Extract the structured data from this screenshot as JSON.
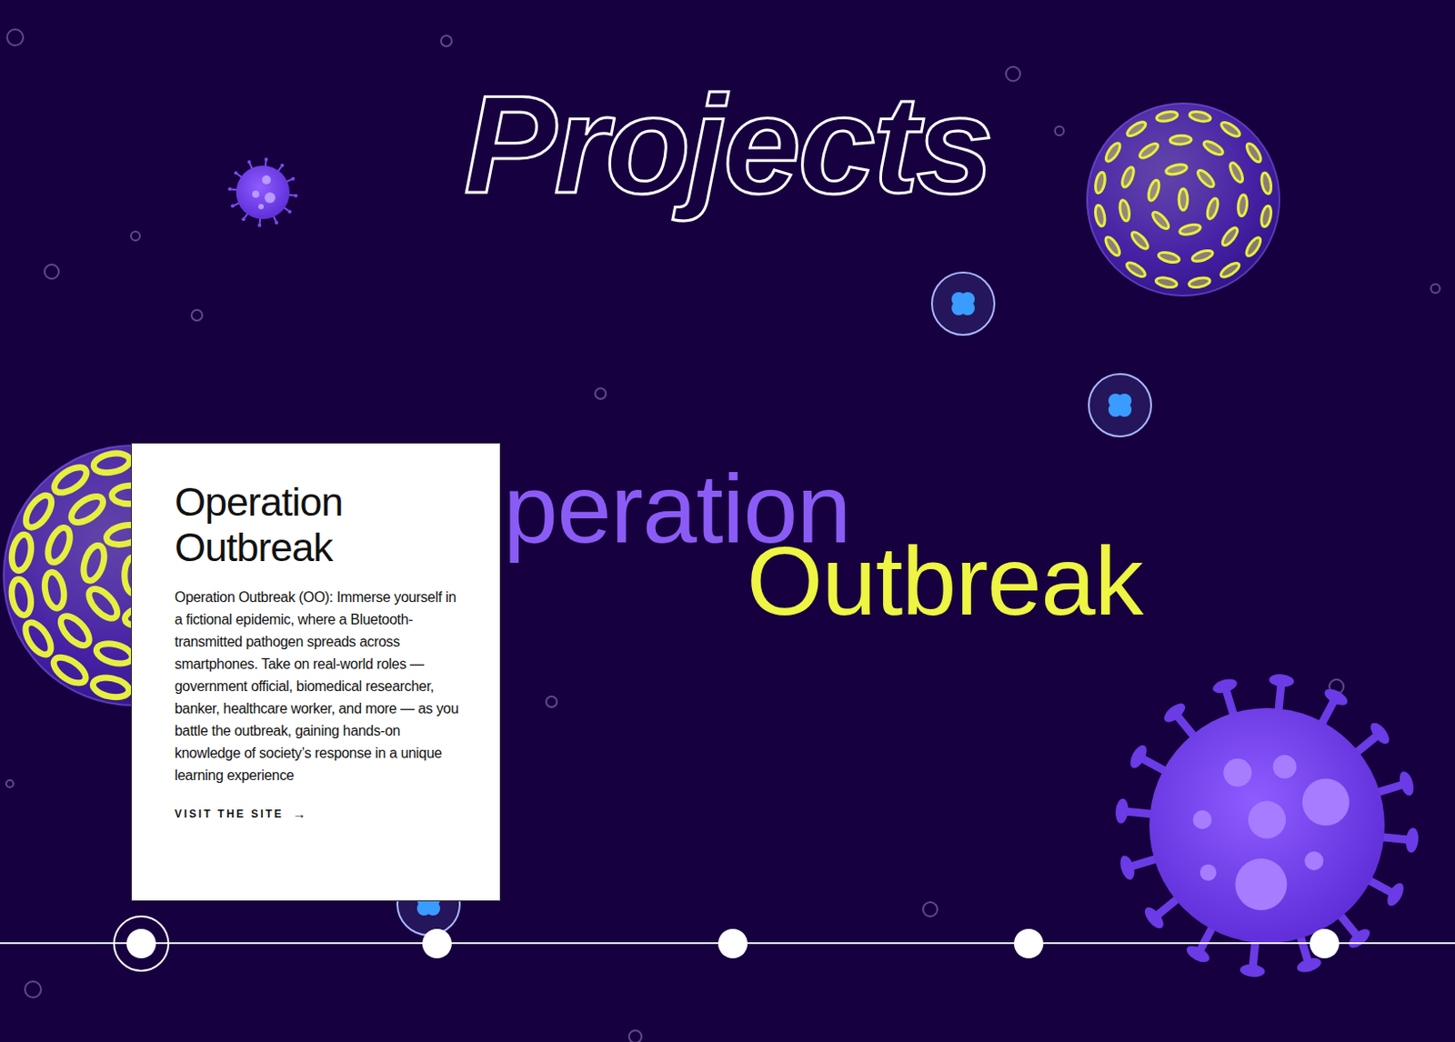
{
  "page": {
    "title": "Projects"
  },
  "hero": {
    "line1": "peration",
    "line2": "Outbreak"
  },
  "card": {
    "title": "Operation Outbreak",
    "description": "Operation Outbreak (OO): Immerse yourself in a fictional epidemic, where a Bluetooth-transmitted pathogen spreads across smartphones. Take on real-world roles — government official, biomedical researcher, banker, healthcare worker, and more — as you battle the outbreak, gaining hands-on knowledge of society’s response in a unique learning experience",
    "link": "VISIT THE SITE",
    "link_icon": "→"
  },
  "timeline": [
    {
      "selected": true
    },
    {
      "selected": false
    },
    {
      "selected": false
    },
    {
      "selected": false
    },
    {
      "selected": false
    }
  ]
}
